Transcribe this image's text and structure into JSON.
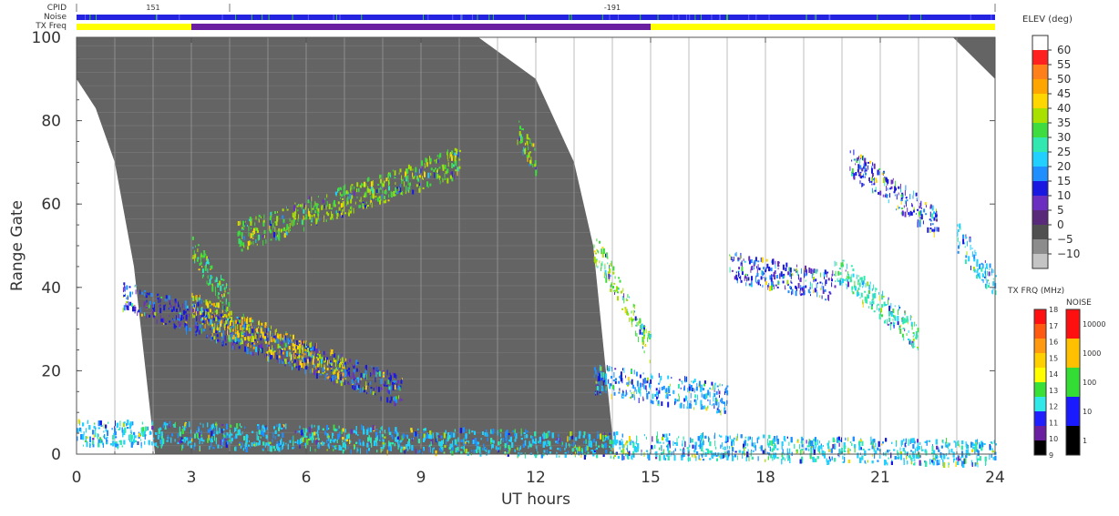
{
  "header": {
    "labels": [
      "CPID",
      "Noise",
      "TX Freq"
    ],
    "cpid_values": [
      "151",
      "-191"
    ],
    "cpid_changes_ut": [
      0,
      4,
      24
    ],
    "txfreq_low_band_ut": [
      3,
      15
    ]
  },
  "chart_data": {
    "type": "heatmap",
    "title": "",
    "xlabel": "UT hours",
    "ylabel": "Range Gate",
    "xlim": [
      0,
      24
    ],
    "ylim": [
      0,
      100
    ],
    "x_ticks": [
      "0",
      "3",
      "6",
      "9",
      "12",
      "15",
      "18",
      "21",
      "24"
    ],
    "y_ticks": [
      "0",
      "20",
      "40",
      "60",
      "80",
      "100"
    ],
    "vertical_grid_hours": [
      1,
      2,
      3,
      4,
      5,
      6,
      7,
      8,
      9,
      10,
      11,
      12,
      13,
      14,
      15,
      16,
      17,
      18,
      19,
      20,
      21,
      22,
      23
    ],
    "grey_region": {
      "description_points_left_edge": [
        [
          0,
          90
        ],
        [
          0.5,
          83
        ],
        [
          1.0,
          70
        ],
        [
          1.5,
          45
        ],
        [
          2.05,
          0
        ]
      ],
      "description_points_right_edge": [
        [
          10.5,
          100
        ],
        [
          12,
          90
        ],
        [
          13,
          70
        ],
        [
          13.5,
          50
        ],
        [
          14.05,
          0
        ]
      ],
      "late_grey_corner": [
        [
          22.9,
          100
        ],
        [
          24,
          90
        ]
      ]
    },
    "scatter_clusters": [
      {
        "name": "",
        "ut_start": 1.2,
        "ut_end": 8.5,
        "gate_start": 38,
        "gate_end": 15,
        "elev": 15
      },
      {
        "name": "",
        "ut_start": 3.0,
        "ut_end": 7.0,
        "gate_start": 35,
        "gate_end": 20,
        "elev": 45
      },
      {
        "name": "",
        "ut_start": 3.0,
        "ut_end": 4.0,
        "gate_start": 50,
        "gate_end": 36,
        "elev": 35
      },
      {
        "name": "",
        "ut_start": 4.2,
        "ut_end": 10.0,
        "gate_start": 52,
        "gate_end": 70,
        "elev": 38
      },
      {
        "name": "",
        "ut_start": 11.5,
        "ut_end": 12.0,
        "gate_start": 78,
        "gate_end": 70,
        "elev": 38
      },
      {
        "name": "",
        "ut_start": 13.5,
        "ut_end": 15.0,
        "gate_start": 50,
        "gate_end": 25,
        "elev": 38
      },
      {
        "name": "",
        "ut_start": 13.5,
        "ut_end": 17.0,
        "gate_start": 18,
        "gate_end": 13,
        "elev": 20
      },
      {
        "name": "",
        "ut_start": 17.0,
        "ut_end": 19.8,
        "gate_start": 45,
        "gate_end": 40,
        "elev": 15
      },
      {
        "name": "",
        "ut_start": 20.2,
        "ut_end": 22.5,
        "gate_start": 70,
        "gate_end": 55,
        "elev": 15
      },
      {
        "name": "",
        "ut_start": 19.8,
        "ut_end": 22.0,
        "gate_start": 45,
        "gate_end": 28,
        "elev": 30
      },
      {
        "name": "",
        "ut_start": 23.0,
        "ut_end": 24.0,
        "gate_start": 52,
        "gate_end": 40,
        "elev": 25
      },
      {
        "name": "",
        "ut_start": 0.0,
        "ut_end": 24.0,
        "gate_start": 5,
        "gate_end": 0,
        "elev": 25
      }
    ],
    "elev_colorbar": {
      "label": "ELEV (deg)",
      "tick_labels": [
        "60",
        "55",
        "50",
        "45",
        "40",
        "35",
        "30",
        "25",
        "20",
        "15",
        "10",
        "5",
        "0",
        "−5",
        "−10"
      ],
      "colors": [
        "#ffffff",
        "#ff2020",
        "#ff7f1a",
        "#ffa500",
        "#ffd700",
        "#a8e000",
        "#3fdc3f",
        "#30e8b0",
        "#22d0ff",
        "#1f8fff",
        "#1818e0",
        "#6a2fc0",
        "#5a2a7a",
        "#505050",
        "#8c8c8c",
        "#c4c4c4"
      ]
    },
    "txfrq_colorbar": {
      "label": "TX FRQ (MHz)",
      "tick_labels": [
        "18",
        "17",
        "16",
        "15",
        "14",
        "13",
        "12",
        "11",
        "10",
        "9"
      ],
      "colors": [
        "#ff1010",
        "#ff5a10",
        "#ff9a10",
        "#ffd000",
        "#ffff00",
        "#38e038",
        "#30e8e8",
        "#2020ff",
        "#6a1fa0",
        "#000000"
      ]
    },
    "noise_colorbar": {
      "label": "NOISE",
      "tick_labels": [
        "10000",
        "1000",
        "100",
        "10",
        "1"
      ],
      "colors": [
        "#ff1010",
        "#ffc000",
        "#33dd33",
        "#1a1aff",
        "#000000"
      ]
    }
  }
}
